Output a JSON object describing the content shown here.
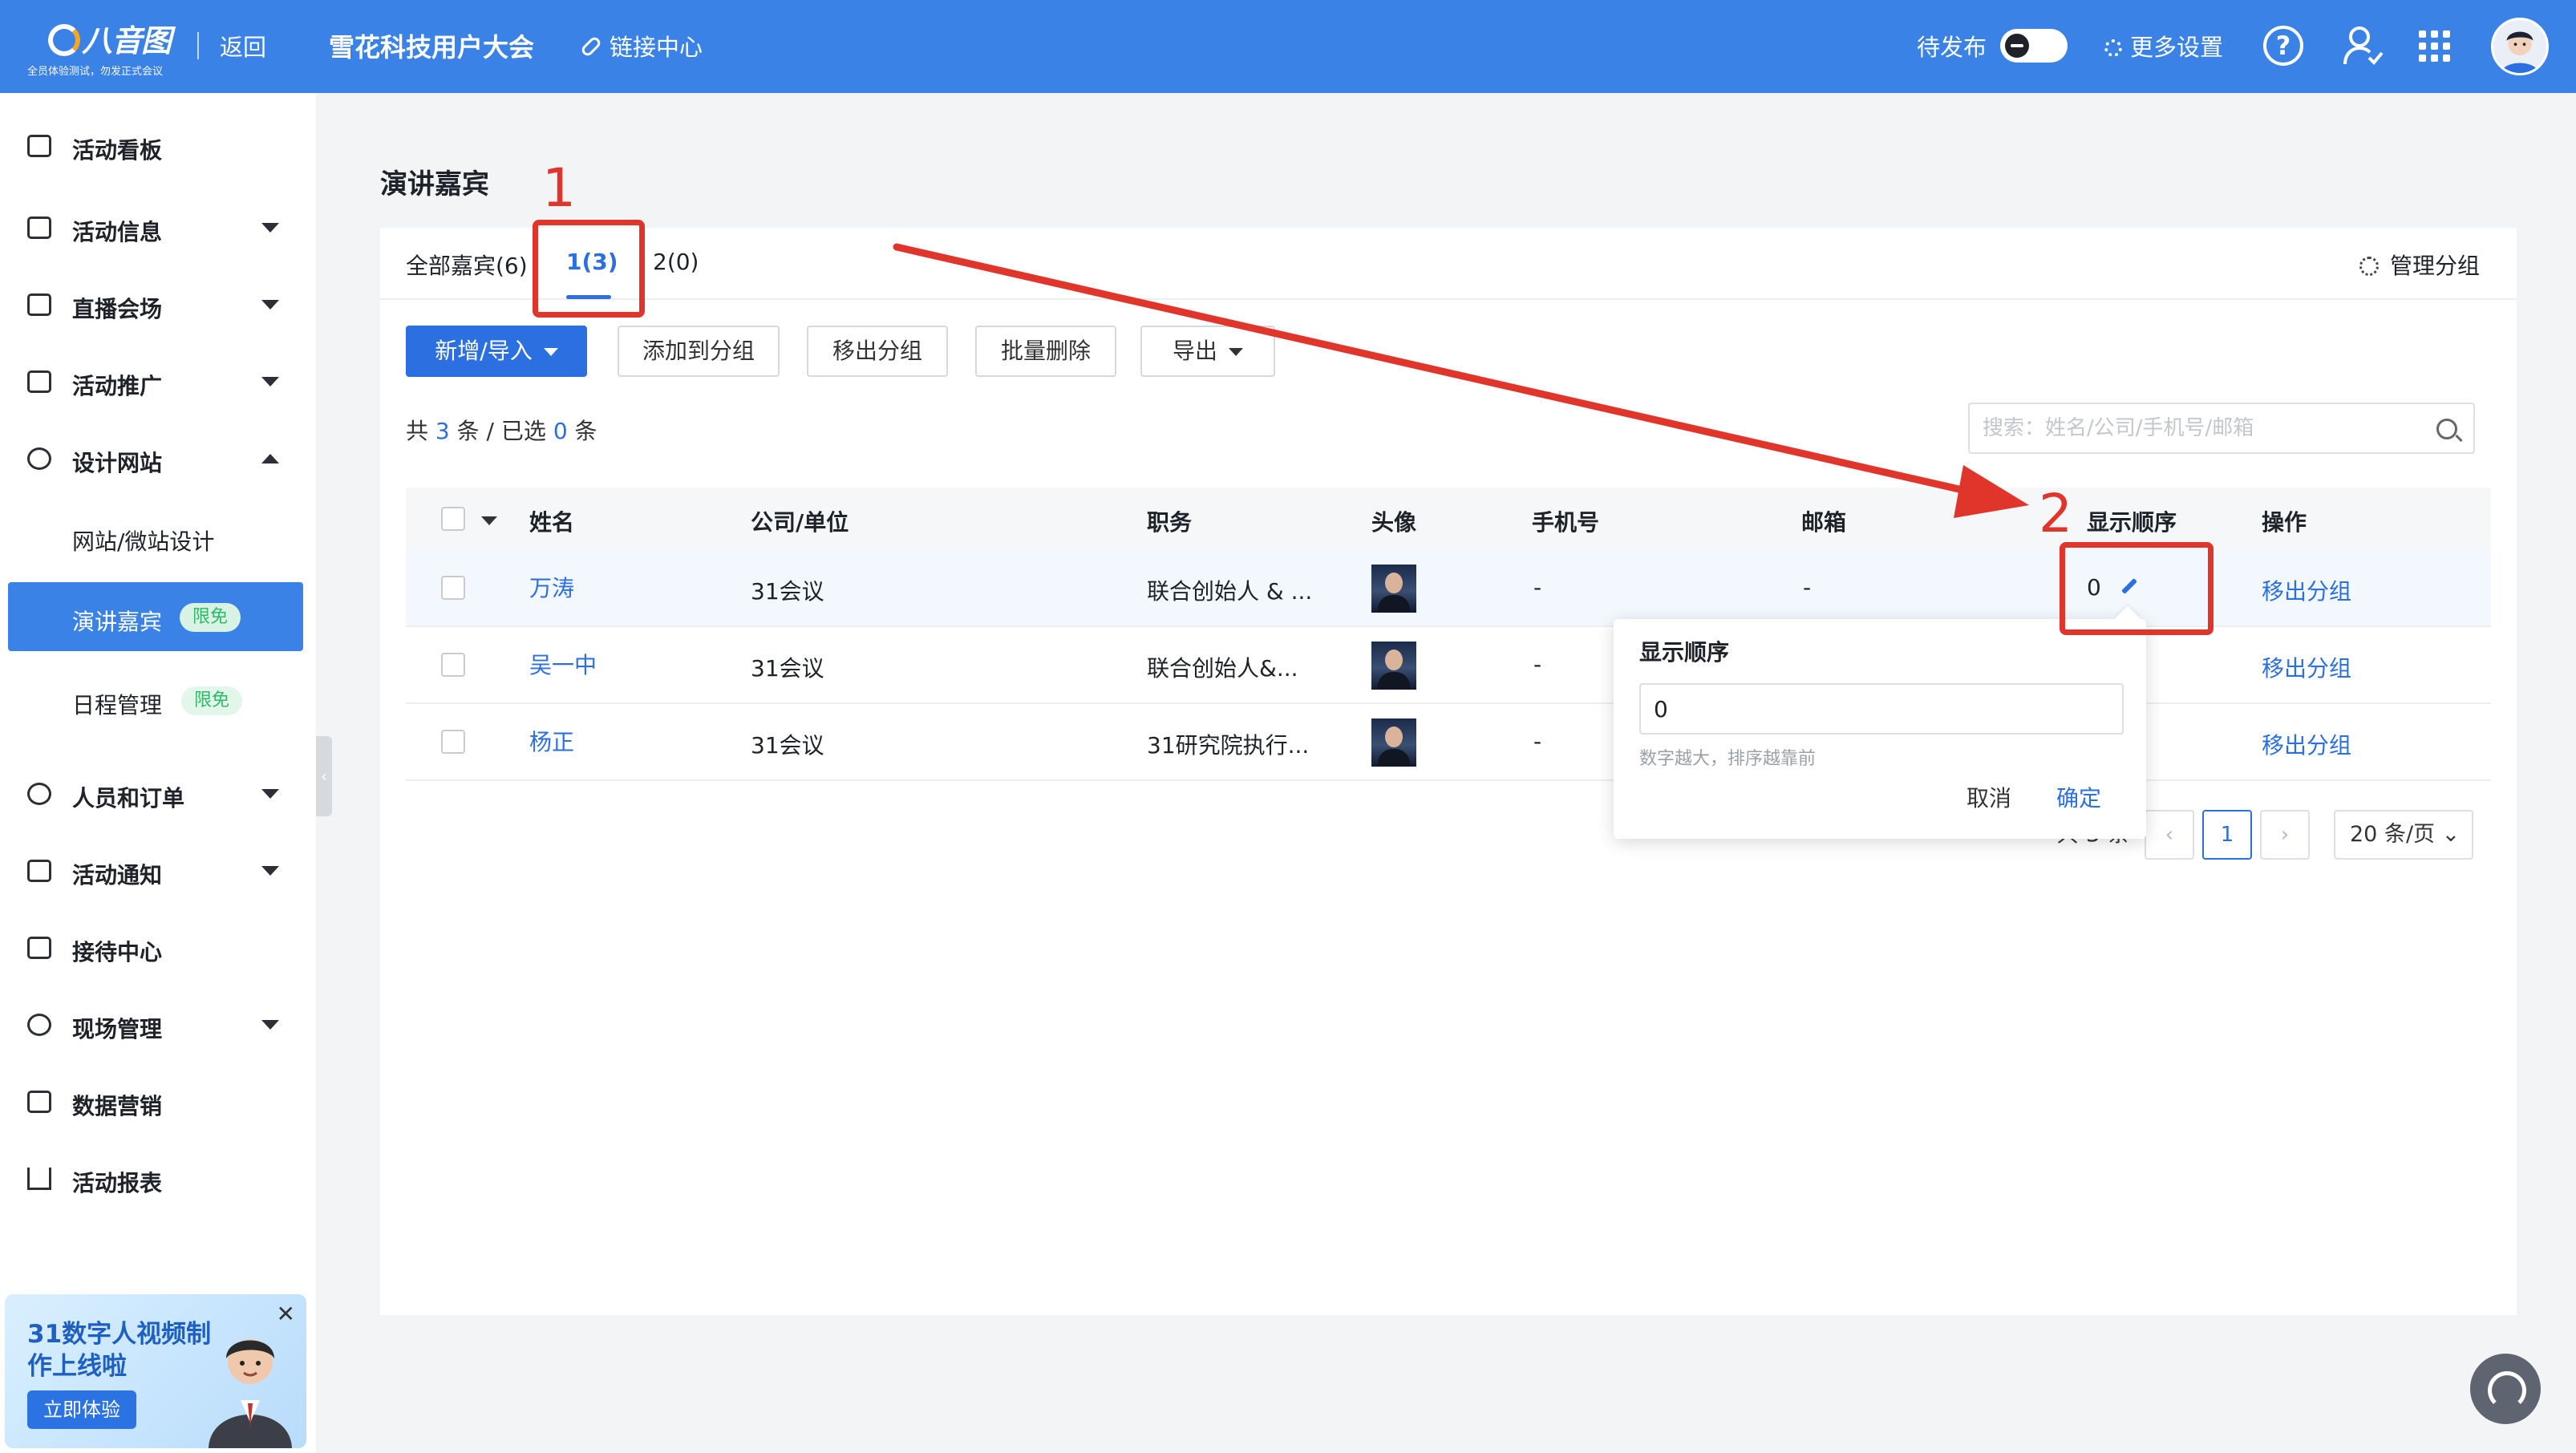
{
  "colors": {
    "topbar": "#3b82e6",
    "primary": "#2b6fe0",
    "annotation": "#e0352b",
    "free_badge": "#2fb867"
  },
  "header": {
    "logo_text": "八音图",
    "logo_sub": "全员体验测试，勿发正式会议",
    "back": "返回",
    "event_title": "雪花科技用户大会",
    "link_center": "链接中心",
    "pending": "待发布",
    "more_settings": "更多设置",
    "icons": [
      "help-icon",
      "user-icon",
      "grid-icon",
      "avatar"
    ]
  },
  "sidebar": {
    "items": [
      {
        "label": "活动看板",
        "icon": "calendar-icon"
      },
      {
        "label": "活动信息",
        "icon": "document-icon"
      },
      {
        "label": "直播会场",
        "icon": "live-icon"
      },
      {
        "label": "活动推广",
        "icon": "cast-icon"
      },
      {
        "label": "设计网站",
        "icon": "compass-icon"
      },
      {
        "label": "网站/微站设计"
      },
      {
        "label": "演讲嘉宾",
        "badge": "限免"
      },
      {
        "label": "日程管理",
        "badge": "限免"
      },
      {
        "label": "人员和订单",
        "icon": "people-icon"
      },
      {
        "label": "活动通知",
        "icon": "message-icon"
      },
      {
        "label": "接待中心",
        "icon": "suitcase-icon"
      },
      {
        "label": "现场管理",
        "icon": "target-icon"
      },
      {
        "label": "数据营销",
        "icon": "chart-icon"
      },
      {
        "label": "活动报表",
        "icon": "bar-chart-icon"
      }
    ],
    "promo": {
      "title": "31数字人视频制作上线啦",
      "button": "立即体验"
    }
  },
  "main": {
    "page_title": "演讲嘉宾",
    "tabs": [
      {
        "label": "全部嘉宾(6)"
      },
      {
        "label": "1(3)"
      },
      {
        "label": "2(0)"
      }
    ],
    "manage_groups": "管理分组",
    "toolbar": {
      "add_import": "新增/导入",
      "add_to_group": "添加到分组",
      "remove_from_group": "移出分组",
      "batch_delete": "批量删除",
      "export": "导出"
    },
    "count": {
      "prefix": "共",
      "total": "3",
      "mid": "条 / 已选",
      "selected": "0",
      "suffix": "条"
    },
    "search_placeholder": "搜索：姓名/公司/手机号/邮箱",
    "columns": [
      "姓名",
      "公司/单位",
      "职务",
      "头像",
      "手机号",
      "邮箱",
      "显示顺序",
      "操作"
    ],
    "rows": [
      {
        "name": "万涛",
        "company": "31会议",
        "title": "联合创始人 & ...",
        "phone": "-",
        "email": "-",
        "order": "0",
        "action": "移出分组"
      },
      {
        "name": "吴一中",
        "company": "31会议",
        "title": "联合创始人&...",
        "phone": "-",
        "email": "",
        "order": "",
        "action": "移出分组"
      },
      {
        "name": "杨正",
        "company": "31会议",
        "title": "31研究院执行...",
        "phone": "-",
        "email": "",
        "order": "",
        "action": "移出分组"
      }
    ],
    "pagination": {
      "total": "共 3 条",
      "prev": "‹",
      "current": "1",
      "next": "›",
      "page_size": "20 条/页"
    },
    "popover": {
      "title": "显示顺序",
      "value": "0",
      "hint": "数字越大，排序越靠前",
      "cancel": "取消",
      "confirm": "确定"
    }
  },
  "annotations": {
    "label_1": "1",
    "label_2": "2"
  }
}
